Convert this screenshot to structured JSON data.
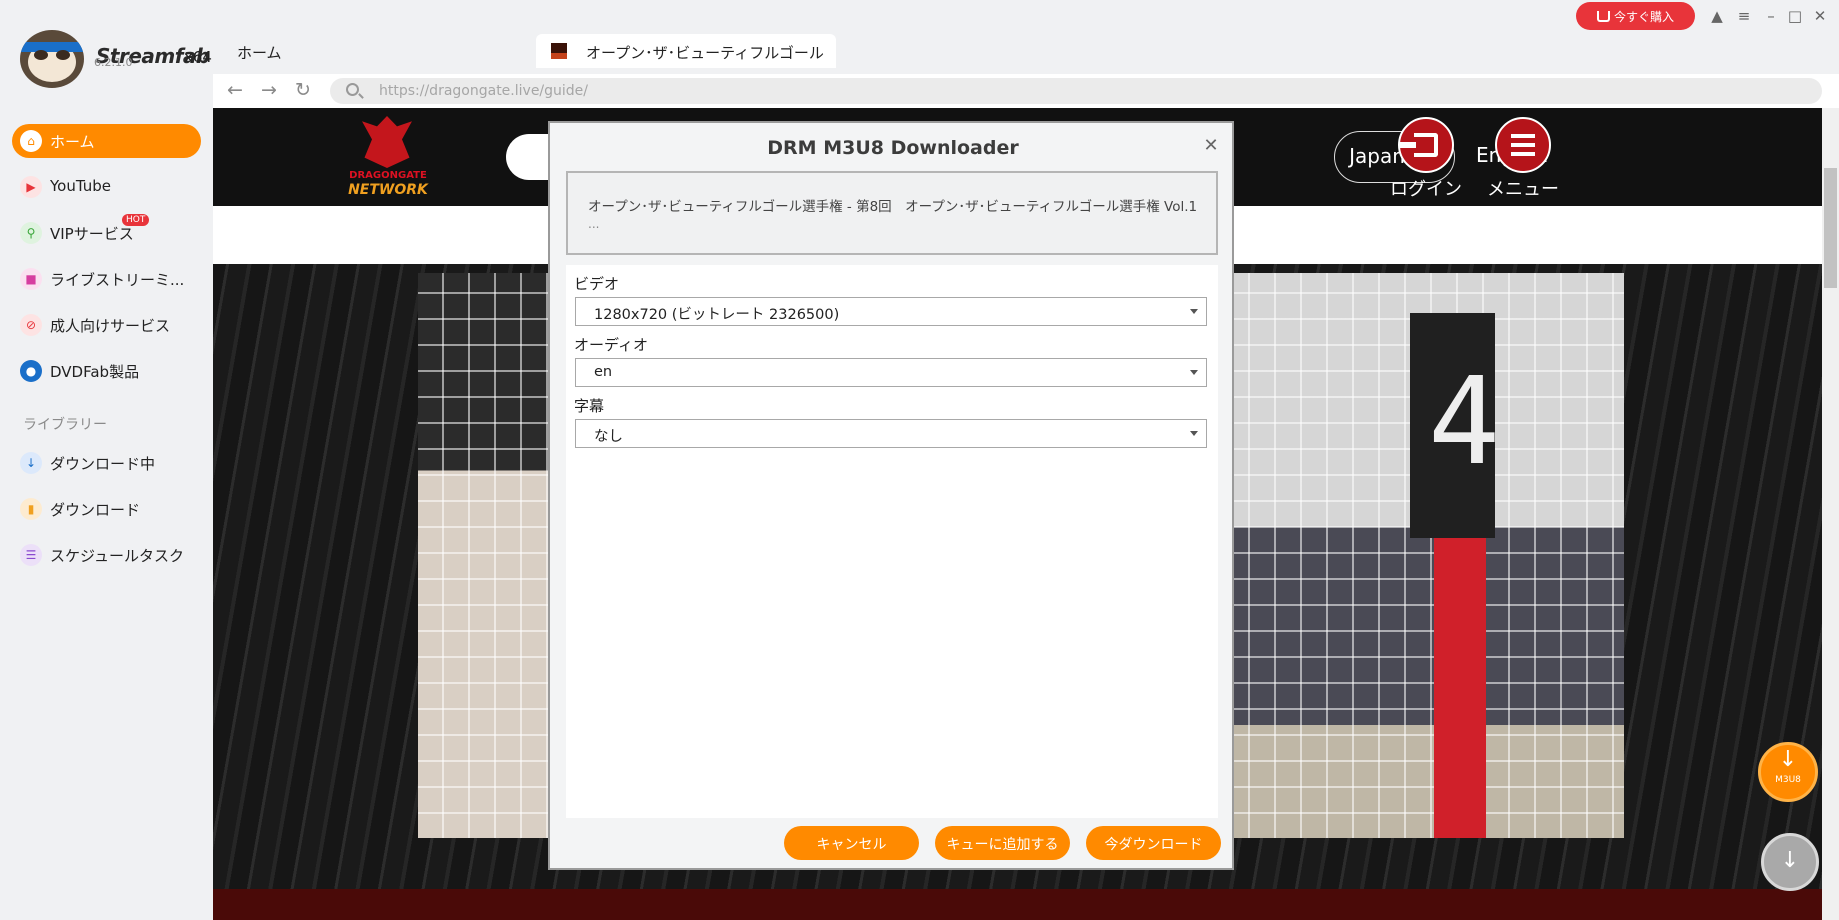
{
  "app": {
    "brand": "Streamfab",
    "arch": "x64",
    "version": "6.2.1.0"
  },
  "tabs": [
    {
      "label": "ホーム"
    },
    {
      "label": "オープン･ザ･ビューティフルゴール"
    }
  ],
  "titlebar": {
    "buy_label": "今すぐ購入",
    "buy_color": "#e8343a"
  },
  "address": {
    "url": "https://dragongate.live/guide/"
  },
  "sidebar": {
    "items": [
      {
        "label": "ホーム",
        "icon": "home-icon"
      },
      {
        "label": "YouTube",
        "icon": "youtube-icon"
      },
      {
        "label": "VIPサービス",
        "icon": "key-icon",
        "badge": "HOT"
      },
      {
        "label": "ライブストリーミ...",
        "icon": "camera-icon"
      },
      {
        "label": "成人向けサービス",
        "icon": "adult-icon"
      },
      {
        "label": "DVDFab製品",
        "icon": "dvdfab-icon"
      }
    ],
    "library_label": "ライブラリー",
    "library": [
      {
        "label": "ダウンロード中",
        "icon": "download-icon"
      },
      {
        "label": "ダウンロード",
        "icon": "folder-icon"
      },
      {
        "label": "スケジュールタスク",
        "icon": "schedule-icon"
      }
    ],
    "accent": "#ff8a00"
  },
  "site": {
    "logo_line1": "DRAGONGATE",
    "logo_line2": "NETWORK",
    "lang_ja": "Japanese",
    "lang_en": "English",
    "login_label": "ログイン",
    "menu_label": "メニュー",
    "video_number": "4"
  },
  "dialog": {
    "title": "DRM M3U8 Downloader",
    "video_title": "オープン･ザ･ビューティフルゴール選手権 - 第8回　オープン･ザ･ビューティフルゴール選手権 Vol.1",
    "video_title_more": "...",
    "video_label": "ビデオ",
    "video_value": "1280x720 (ビットレート 2326500)",
    "audio_label": "オーディオ",
    "audio_value": "en",
    "subtitle_label": "字幕",
    "subtitle_value": "なし",
    "cancel_label": "キャンセル",
    "queue_label": "キューに追加する",
    "download_label": "今ダウンロード"
  },
  "floating": {
    "m3u8_label": "M3U8"
  }
}
